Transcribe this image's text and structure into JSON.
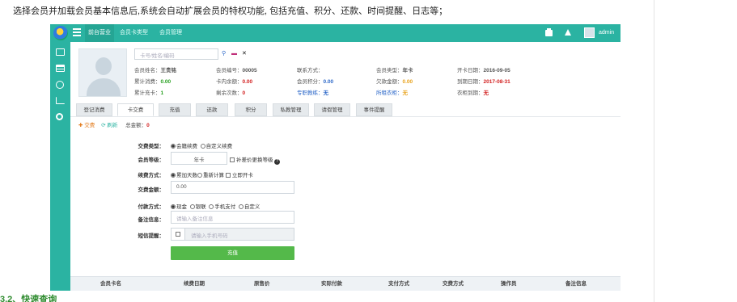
{
  "doc": {
    "intro": "选择会员并加载会员基本信息后,系统会自动扩展会员的特权功能, 包括充值、积分、还款、时间提醒、日志等；",
    "section_heading": "3.2、快速查询"
  },
  "topbar": {
    "nav": [
      "前台营业",
      "会员卡类型",
      "会员管理"
    ],
    "user": "admin"
  },
  "member": {
    "search_placeholder": "卡号/姓名/编码",
    "rows": [
      [
        {
          "label": "会员姓名：",
          "value": "王贵铭",
          "color": ""
        },
        {
          "label": "会员编号：",
          "value": "00005",
          "color": ""
        },
        {
          "label": "联系方式：",
          "value": "",
          "color": ""
        },
        {
          "label": "会员类型：",
          "value": "年卡",
          "color": ""
        },
        {
          "label": "开卡日期：",
          "value": "2016-09-05",
          "color": ""
        }
      ],
      [
        {
          "label": "累计消费：",
          "value": "0.00",
          "color": "green"
        },
        {
          "label": "卡内余额：",
          "value": "0.00",
          "color": "red"
        },
        {
          "label": "会员积分：",
          "value": "0.00",
          "color": "blue"
        },
        {
          "label": "欠款金额：",
          "value": "0.00",
          "color": "orange"
        },
        {
          "label": "到期日期：",
          "value": "2017-08-31",
          "color": "red"
        }
      ],
      [
        {
          "label": "累计充卡：",
          "value": "1",
          "color": "green"
        },
        {
          "label": "剩余次数：",
          "value": "0",
          "color": "red"
        },
        {
          "label": "专职教练：",
          "value": "无",
          "color": "blue"
        },
        {
          "label": "所租衣柜：",
          "value": "无",
          "color": "orange"
        },
        {
          "label": "衣柜到期：",
          "value": "无",
          "color": "red"
        }
      ]
    ]
  },
  "tabs": [
    "登记消费",
    "卡交费",
    "充值",
    "还款",
    "积分",
    "私教管理",
    "请假管理",
    "事件提醒"
  ],
  "actions": {
    "add": "交费",
    "refresh": "刷新",
    "total_label": "总金额：",
    "total_value": "0"
  },
  "form": {
    "fee_type": {
      "label": "交费类型：",
      "options": [
        "会籍续费",
        "自定义续费"
      ]
    },
    "level": {
      "label": "会员等级：",
      "value": "年卡",
      "upgrade": "补差价更换等级"
    },
    "renew_mode": {
      "label": "续费方式：",
      "options": [
        "累加天数",
        "重新计算"
      ],
      "open_card": "立即开卡"
    },
    "amount": {
      "label": "交费金额：",
      "value": "0.00"
    },
    "pay_method": {
      "label": "付款方式：",
      "options": [
        "现金",
        "银联",
        "手机支付",
        "自定义"
      ]
    },
    "note": {
      "label": "备注信息：",
      "placeholder": "请输入备注信息"
    },
    "sms": {
      "label": "短信提醒：",
      "placeholder": "请输入手机号码"
    },
    "submit": "充值"
  },
  "table": {
    "headers": [
      "会员卡名",
      "续费日期",
      "原售价",
      "实际付款",
      "支付方式",
      "交费方式",
      "操作员",
      "备注信息"
    ]
  }
}
